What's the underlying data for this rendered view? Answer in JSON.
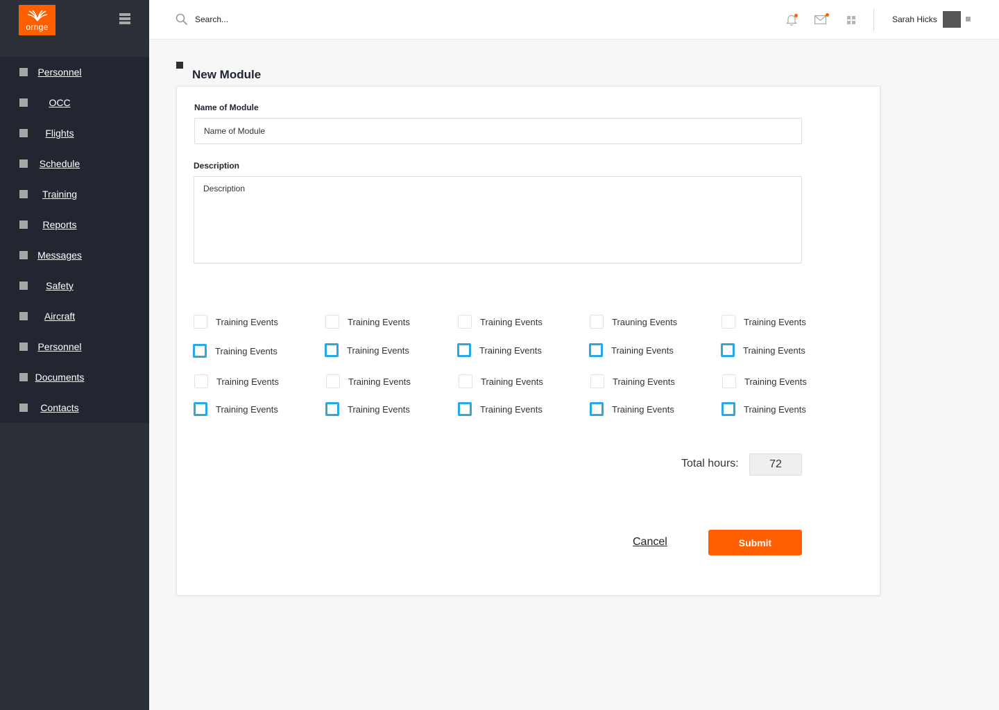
{
  "brand": {
    "logo_text": "ornge",
    "accent_color": "#ff5f00"
  },
  "sidebar": {
    "items": [
      {
        "label": "Personnel"
      },
      {
        "label": "OCC"
      },
      {
        "label": "Flights"
      },
      {
        "label": "Schedule"
      },
      {
        "label": "Training"
      },
      {
        "label": "Reports"
      },
      {
        "label": "Messages"
      },
      {
        "label": "Safety"
      },
      {
        "label": "Aircraft"
      },
      {
        "label": "Personnel"
      },
      {
        "label": "Documents"
      },
      {
        "label": "Contacts"
      }
    ]
  },
  "header": {
    "search_placeholder": "Search...",
    "user_name": "Sarah Hicks",
    "icons": [
      "bell-icon",
      "mail-icon",
      "grid-icon"
    ]
  },
  "page": {
    "title": "New Module"
  },
  "form": {
    "name_label": "Name of Module",
    "name_placeholder": "Name of Module",
    "description_label": "Description",
    "description_placeholder": "Description",
    "checkbox_rows": [
      {
        "style": "plain",
        "labels": [
          "Training Events",
          "Training Events",
          "Training Events",
          "Trauning Events",
          "Training Events"
        ]
      },
      {
        "style": "blue",
        "labels": [
          "Training Events",
          "Training Events",
          "Training Events",
          "Training Events",
          "Training Events"
        ]
      },
      {
        "style": "plain",
        "labels": [
          "Training Events",
          "Training Events",
          "Training Events",
          "Training Events",
          "Training Events"
        ]
      },
      {
        "style": "blue",
        "labels": [
          "Training Events",
          "Training Events",
          "Training Events",
          "Training Events",
          "Training Events"
        ]
      }
    ],
    "total_label": "Total hours:",
    "total_value": "72",
    "cancel_label": "Cancel",
    "submit_label": "Submit"
  }
}
